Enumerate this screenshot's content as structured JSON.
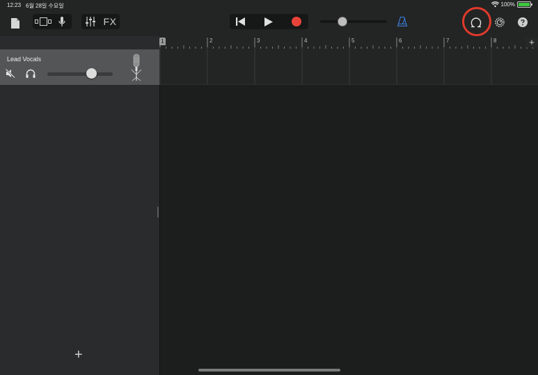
{
  "status_bar": {
    "time": "12:23",
    "date": "6월 28일 수요일",
    "battery": "100%"
  },
  "toolbar": {
    "fx_label": "FX"
  },
  "ruler": {
    "bars": [
      "1",
      "2",
      "3",
      "4",
      "5",
      "6",
      "7",
      "8"
    ],
    "add_label": "+"
  },
  "track": {
    "name": "Lead Vocals",
    "volume": 0.68
  },
  "track_list": {
    "add_label": "+"
  },
  "colors": {
    "record": "#e8433a",
    "metronome": "#3a7bd5",
    "highlight": "#e03a2c",
    "battery": "#3ec63e"
  }
}
